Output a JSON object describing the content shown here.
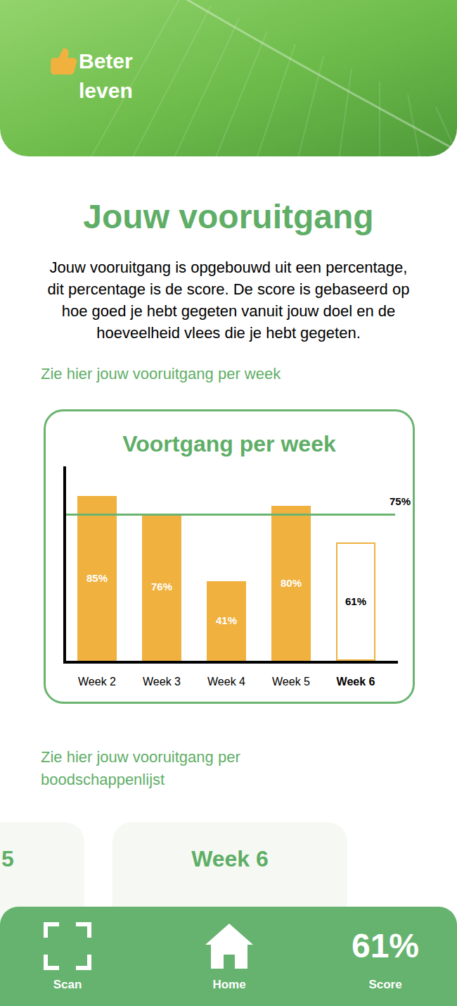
{
  "header": {
    "logo_lines": [
      "Beter",
      "leven"
    ]
  },
  "title": "Jouw vooruitgang",
  "intro": "Jouw vooruitgang is opgebouwd uit een percentage, dit percentage is de score. De score is gebaseerd op hoe goed je hebt gegeten vanuit jouw doel en de hoeveelheid vlees die je hebt gegeten.",
  "week_section_label": "Zie hier jouw vooruitgang per week",
  "chart": {
    "title": "Voortgang per week",
    "target": {
      "value": 75,
      "label": "75%"
    },
    "bars": [
      {
        "label": "Week 2",
        "value": 85,
        "reading": "85%",
        "selected": false
      },
      {
        "label": "Week 3",
        "value": 76,
        "reading": "76%",
        "selected": false
      },
      {
        "label": "Week 4",
        "value": 41,
        "reading": "41%",
        "selected": false
      },
      {
        "label": "Week 5",
        "value": 80,
        "reading": "80%",
        "selected": false
      },
      {
        "label": "Week 6",
        "value": 61,
        "reading": "61%",
        "selected": true
      }
    ]
  },
  "list_section_label": "Zie hier jouw vooruitgang per boodschappenlijst",
  "lists": [
    {
      "title": "5"
    },
    {
      "title": "Week 6"
    }
  ],
  "nav": [
    {
      "kind": "scan",
      "label": "Scan"
    },
    {
      "kind": "home",
      "label": "Home"
    },
    {
      "kind": "value",
      "value": "61%",
      "label": "Score"
    }
  ]
}
